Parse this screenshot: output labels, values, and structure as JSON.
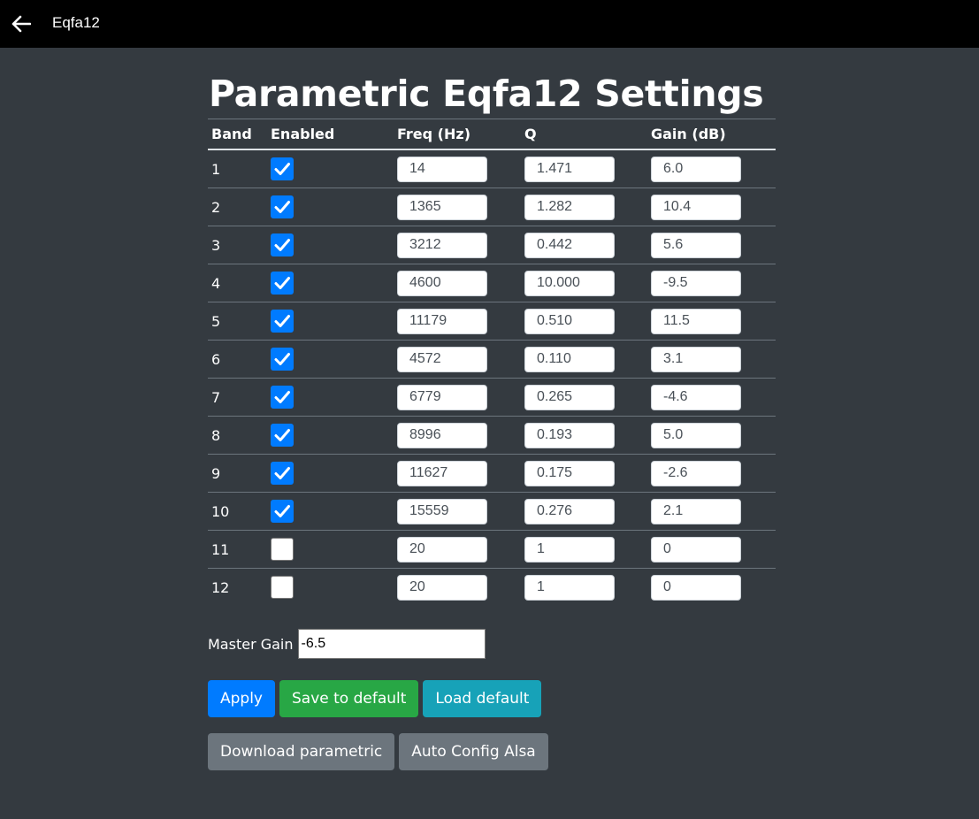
{
  "app": {
    "title": "Eqfa12"
  },
  "page": {
    "title": "Parametric Eqfa12 Settings"
  },
  "table": {
    "headers": {
      "band": "Band",
      "enabled": "Enabled",
      "freq": "Freq (Hz)",
      "q": "Q",
      "gain": "Gain (dB)"
    },
    "rows": [
      {
        "band": "1",
        "enabled": true,
        "freq": "14",
        "q": "1.471",
        "gain": "6.0"
      },
      {
        "band": "2",
        "enabled": true,
        "freq": "1365",
        "q": "1.282",
        "gain": "10.4"
      },
      {
        "band": "3",
        "enabled": true,
        "freq": "3212",
        "q": "0.442",
        "gain": "5.6"
      },
      {
        "band": "4",
        "enabled": true,
        "freq": "4600",
        "q": "10.000",
        "gain": "-9.5"
      },
      {
        "band": "5",
        "enabled": true,
        "freq": "11179",
        "q": "0.510",
        "gain": "11.5"
      },
      {
        "band": "6",
        "enabled": true,
        "freq": "4572",
        "q": "0.110",
        "gain": "3.1"
      },
      {
        "band": "7",
        "enabled": true,
        "freq": "6779",
        "q": "0.265",
        "gain": "-4.6"
      },
      {
        "band": "8",
        "enabled": true,
        "freq": "8996",
        "q": "0.193",
        "gain": "5.0"
      },
      {
        "band": "9",
        "enabled": true,
        "freq": "11627",
        "q": "0.175",
        "gain": "-2.6"
      },
      {
        "band": "10",
        "enabled": true,
        "freq": "15559",
        "q": "0.276",
        "gain": "2.1"
      },
      {
        "band": "11",
        "enabled": false,
        "freq": "20",
        "q": "1",
        "gain": "0"
      },
      {
        "band": "12",
        "enabled": false,
        "freq": "20",
        "q": "1",
        "gain": "0"
      }
    ]
  },
  "master": {
    "label": "Master Gain",
    "value": "-6.5"
  },
  "buttons": {
    "apply": "Apply",
    "save_default": "Save to default",
    "load_default": "Load default",
    "download": "Download parametric",
    "auto_config": "Auto Config Alsa"
  },
  "colors": {
    "background": "#343a40",
    "topbar": "#000000",
    "primary": "#007bff",
    "success": "#28a745",
    "info": "#17a2b8",
    "secondary": "#6c757d"
  },
  "icons": {
    "back": "arrow-left-icon",
    "check": "checkmark-icon"
  }
}
